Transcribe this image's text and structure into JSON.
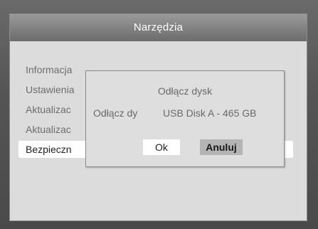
{
  "window": {
    "title": "Narzędzia"
  },
  "menu": {
    "items": [
      {
        "label": "Informacja"
      },
      {
        "label": "Ustawienia"
      },
      {
        "label": "Aktualizac"
      },
      {
        "label": "Aktualizac"
      },
      {
        "label": "Bezpieczn",
        "selected": true
      }
    ]
  },
  "dialog": {
    "title": "Odłącz dysk",
    "row_label": "Odłącz dy",
    "row_value": "USB Disk A - 465 GB",
    "ok_label": "Ok",
    "cancel_label": "Anuluj"
  },
  "colors": {
    "title_bar": "#7a7a7a",
    "panel": "#dcdcdc",
    "selected_item": "#ffffff",
    "focused_button": "#b4b4b4"
  }
}
